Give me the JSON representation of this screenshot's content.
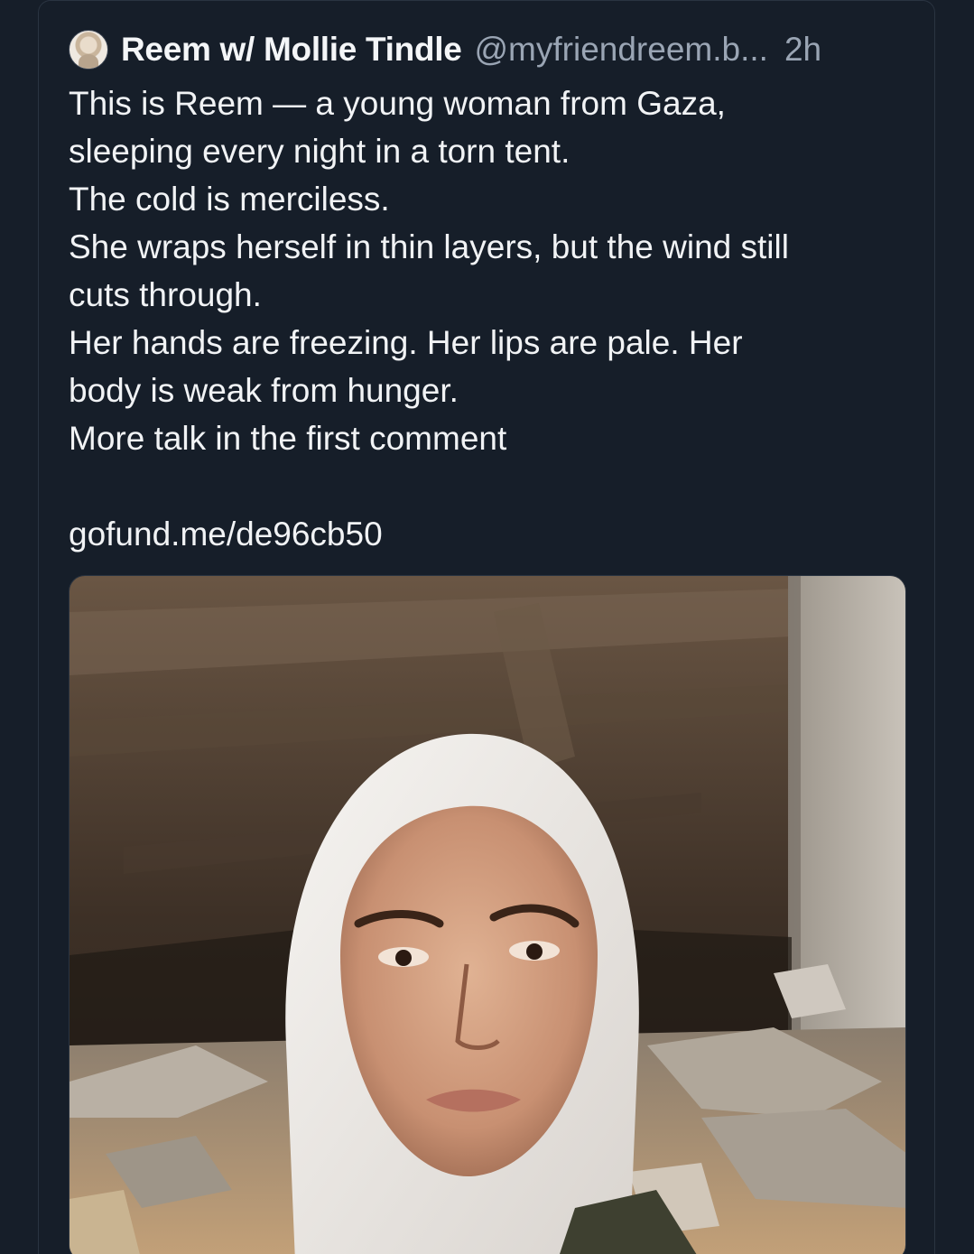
{
  "post": {
    "author": {
      "display_name": "Reem w/ Mollie Tindle",
      "handle": "@myfriendreem.b...",
      "avatar_icon": "user-avatar-photo"
    },
    "timestamp": "2h",
    "body_lines": [
      "This is Reem — a young woman from Gaza,",
      "sleeping every night in a torn tent.",
      "The cold is merciless.",
      "She wraps herself in thin layers, but the wind still",
      "cuts through.",
      "Her hands are freezing. Her lips are pale. Her",
      "body is weak from hunger.",
      "More talk in the first comment"
    ],
    "link": "gofund.me/de96cb50",
    "image": {
      "description_icon": "post-photo"
    }
  },
  "colors": {
    "background": "#161e29",
    "text": "#f1f3f5",
    "muted": "#9aa5b4",
    "border": "#2a3441"
  }
}
